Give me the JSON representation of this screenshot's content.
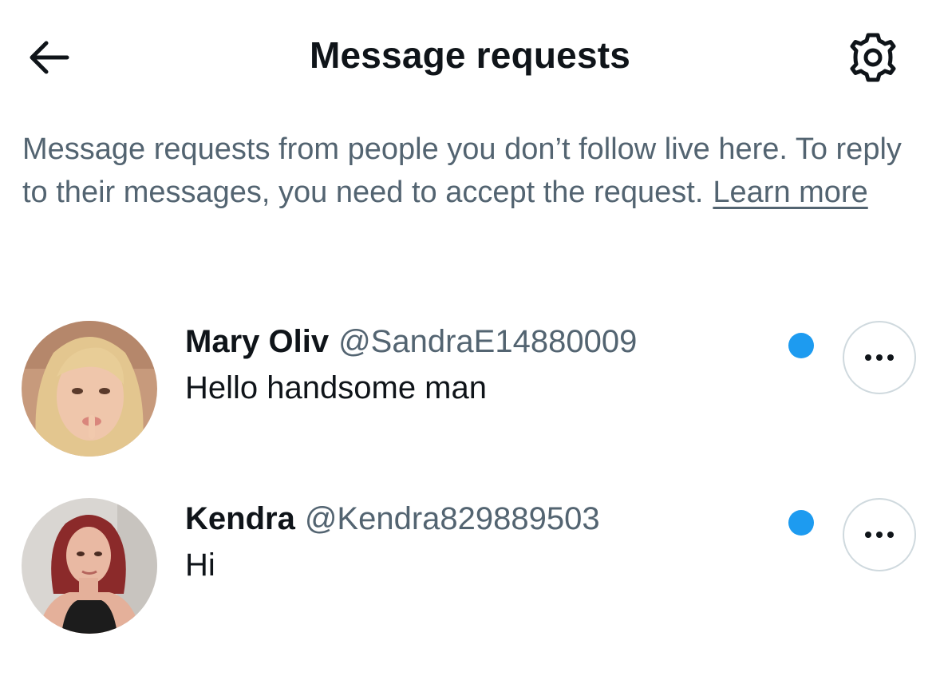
{
  "header": {
    "title": "Message requests",
    "back_icon": "arrow-left-icon",
    "settings_icon": "gear-icon"
  },
  "info": {
    "text": "Message requests from people you don’t follow live here. To reply to their messages, you need to accept the request.",
    "learn_more": "Learn more"
  },
  "requests": [
    {
      "name": "Mary Oliv",
      "handle": "@SandraE14880009",
      "message": "Hello handsome man",
      "unread": true
    },
    {
      "name": "Kendra",
      "handle": "@Kendra829889503",
      "message": "Hi",
      "unread": true
    }
  ],
  "colors": {
    "accent": "#1d9bf0",
    "text_primary": "#0f1419",
    "text_secondary": "#536471",
    "border": "#cfd9de"
  }
}
